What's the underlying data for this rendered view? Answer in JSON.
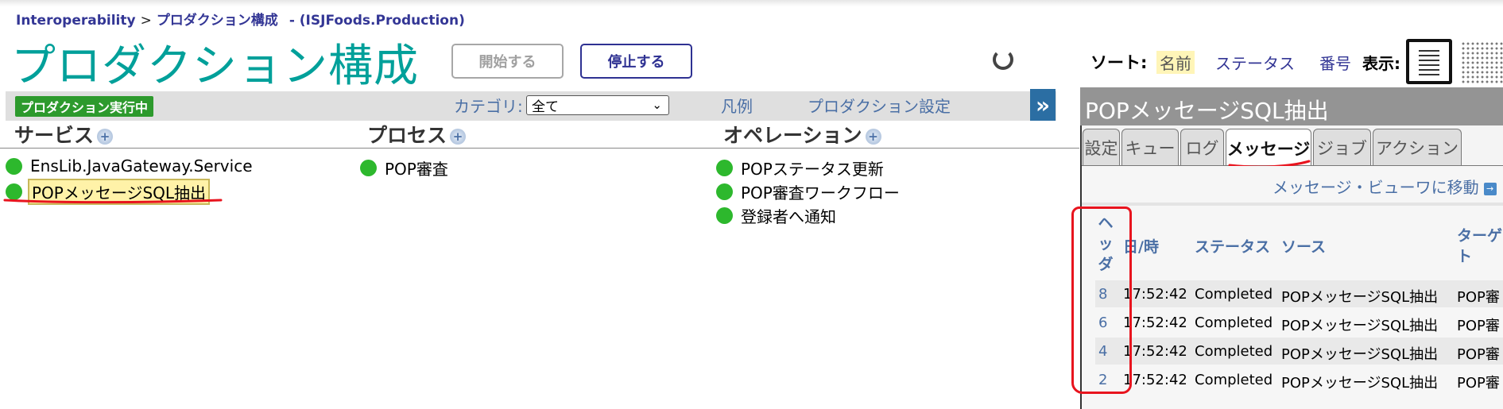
{
  "breadcrumb": {
    "root": "Interoperability",
    "separator": ">",
    "current": "プロダクション構成",
    "namespace": "- (ISJFoods.Production)"
  },
  "page_title": "プロダクション構成",
  "buttons": {
    "start": "開始する",
    "stop": "停止する"
  },
  "sort": {
    "label": "ソート:",
    "options": [
      "名前",
      "ステータス",
      "番号"
    ],
    "selected": "名前"
  },
  "display": {
    "label": "表示:"
  },
  "status_badge": "プロダクション実行中",
  "category": {
    "label": "カテゴリ:",
    "value": "全て"
  },
  "links": {
    "legend": "凡例",
    "production_settings": "プロダクション設定"
  },
  "expand_label": "»",
  "columns": {
    "services": {
      "title": "サービス",
      "items": [
        "EnsLib.JavaGateway.Service",
        "POPメッセージSQL抽出"
      ]
    },
    "processes": {
      "title": "プロセス",
      "items": [
        "POP審査"
      ]
    },
    "operations": {
      "title": "オペレーション",
      "items": [
        "POPステータス更新",
        "POP審査ワークフロー",
        "登録者へ通知"
      ]
    }
  },
  "selected_item": "POPメッセージSQL抽出",
  "right_panel": {
    "title": "POPメッセージSQL抽出",
    "tabs": [
      "設定",
      "キュー",
      "ログ",
      "メッセージ",
      "ジョブ",
      "アクション"
    ],
    "active_tab": "メッセージ",
    "viewer_link": "メッセージ・ビューワに移動",
    "table": {
      "headers": {
        "header_chars": [
          "ヘ",
          "ッ",
          "ダ"
        ],
        "time": "日/時",
        "status": "ステータス",
        "source": "ソース",
        "target_chars": [
          "ターゲ",
          "ト"
        ]
      },
      "rows": [
        {
          "header": "8",
          "time": "17:52:42",
          "status": "Completed",
          "source": "POPメッセージSQL抽出",
          "target": "POP審"
        },
        {
          "header": "6",
          "time": "17:52:42",
          "status": "Completed",
          "source": "POPメッセージSQL抽出",
          "target": "POP審"
        },
        {
          "header": "4",
          "time": "17:52:42",
          "status": "Completed",
          "source": "POPメッセージSQL抽出",
          "target": "POP審"
        },
        {
          "header": "2",
          "time": "17:52:42",
          "status": "Completed",
          "source": "POPメッセージSQL抽出",
          "target": "POP審"
        }
      ]
    }
  },
  "colors": {
    "title": "#00a09a",
    "link": "#4a6fa5",
    "nav": "#333695",
    "status_ok": "#2db82d",
    "badge": "#2d9a2d",
    "annotation": "#e8141e"
  },
  "icons": [
    "spinner-icon",
    "list-view-icon",
    "grid-view-icon",
    "plus-icon",
    "status-dot-icon",
    "external-link-icon",
    "chevron-down-icon"
  ]
}
